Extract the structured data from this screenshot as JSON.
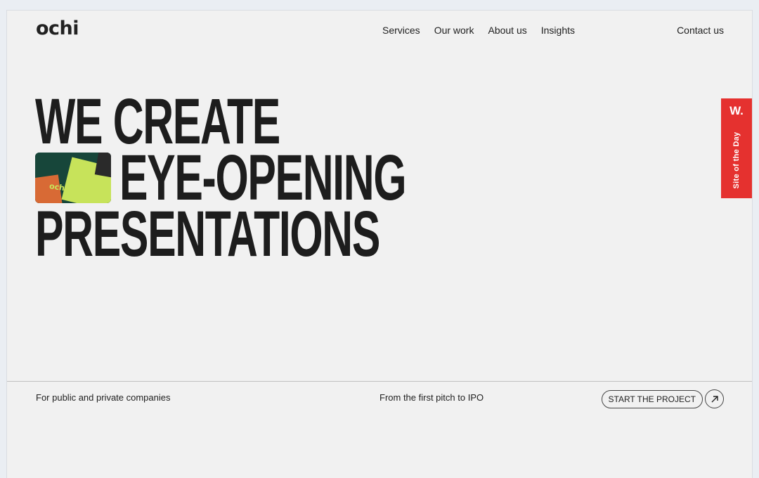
{
  "brand": {
    "logo": "ochi"
  },
  "nav": {
    "items": [
      "Services",
      "Our work",
      "About us",
      "Insights"
    ],
    "contact": "Contact us"
  },
  "hero": {
    "line1": "WE CREATE",
    "line2": "EYE-OPENING",
    "line3": "PRESENTATIONS",
    "thumb_text_1": "ochi",
    "thumb_text_2": "ochi"
  },
  "award": {
    "mark": "W.",
    "label": "Site of the Day"
  },
  "footer": {
    "left": "For public and private companies",
    "middle": "From the first pitch to IPO",
    "cta_label": "START THE PROJECT"
  },
  "colors": {
    "award_red": "#e5312f",
    "accent_green": "#c7e35a",
    "text": "#212121"
  },
  "icons": {
    "cta": "arrow-up-right-icon"
  }
}
